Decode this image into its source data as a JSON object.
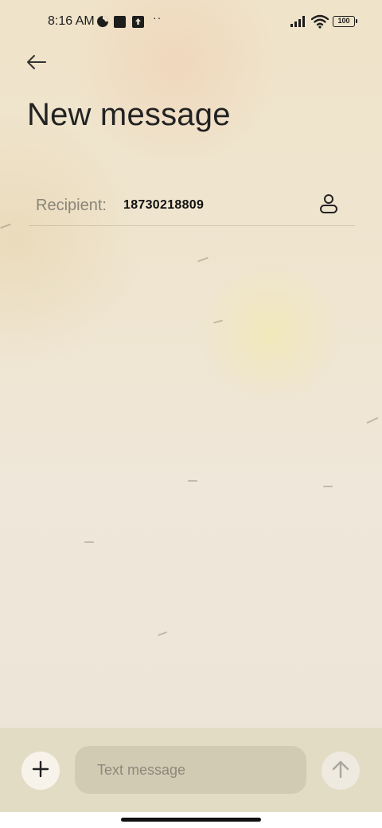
{
  "status_bar": {
    "time": "8:16 AM",
    "icons": [
      "data-saver-icon",
      "notification-square-icon",
      "upload-icon",
      "more-dots-icon",
      "cell-signal-icon",
      "wifi-icon",
      "battery-icon"
    ],
    "dots": "··",
    "battery_level": "100"
  },
  "header": {
    "back_icon": "arrow-left-icon",
    "title": "New message"
  },
  "recipient": {
    "label": "Recipient:",
    "value": "18730218809",
    "contact_icon": "person-icon"
  },
  "composer": {
    "add_icon": "plus-icon",
    "placeholder": "Text message",
    "send_icon": "arrow-up-icon"
  },
  "colors": {
    "composer_background": "#e3dcc4",
    "input_background": "#d2cbb3",
    "label_gray": "#8a8478"
  }
}
